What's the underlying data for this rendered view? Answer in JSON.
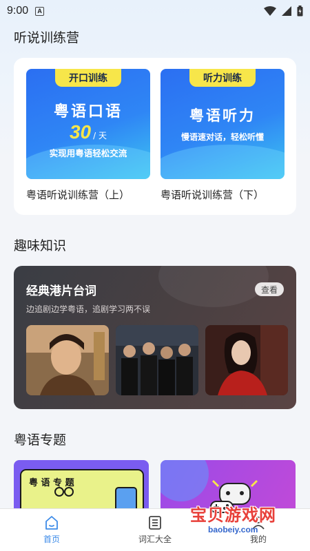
{
  "status_bar": {
    "time": "9:00",
    "notif_letter": "A"
  },
  "sections": {
    "training": "听说训练营",
    "fun_knowledge": "趣味知识",
    "topics": "粤语专题"
  },
  "camps": [
    {
      "tag": "开口训练",
      "line1": "粤语口语",
      "number": "30",
      "unit": "/ 天",
      "line3": "实现用粤语轻松交流",
      "label": "粤语听说训练营（上）"
    },
    {
      "tag": "听力训练",
      "line1": "粤语听力",
      "line3": "慢语速对话，轻松听懂",
      "label": "粤语听说训练营（下）"
    }
  ],
  "knowledge": {
    "title": "经典港片台词",
    "subtitle": "边追剧边学粤语，追剧学习两不误",
    "view_button": "查看"
  },
  "topics": [
    {
      "text": "粤 语 专 题"
    }
  ],
  "bottom_nav": [
    {
      "label": "首页",
      "icon": "home-icon",
      "active": true
    },
    {
      "label": "词汇大全",
      "icon": "book-list-icon",
      "active": false
    },
    {
      "label": "我的",
      "icon": "profile-icon",
      "active": false
    }
  ],
  "watermark": {
    "text": "宝贝游戏网",
    "url": "baobeiy.com"
  },
  "colors": {
    "accent": "#3c8be8",
    "banner_blue": "#2b6ff2",
    "tag_yellow": "#f7e64a",
    "knowledge_bg": "#3a3d44"
  }
}
